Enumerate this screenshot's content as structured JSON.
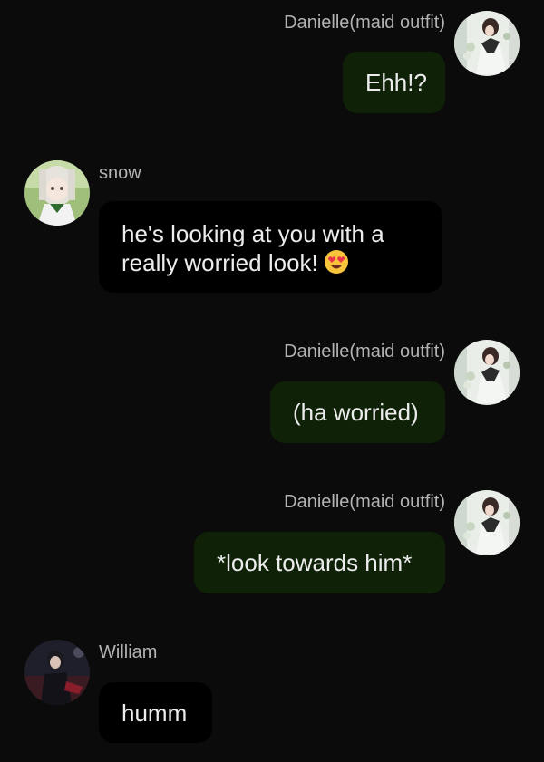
{
  "colors": {
    "background": "#0b0b0b",
    "outgoing_bubble": "#0f2208",
    "incoming_bubble": "#000000",
    "sender_name": "#b3b3b3",
    "message_text": "#ececec"
  },
  "messages": [
    {
      "sender": "Danielle(maid outfit)",
      "text": "Ehh!?",
      "side": "right",
      "avatar": "danielle-avatar"
    },
    {
      "sender": "snow",
      "text_line1": "he's looking at you with a",
      "text_line2": "really worried look!",
      "emoji": "heart-eyes-emoji",
      "side": "left",
      "avatar": "snow-avatar"
    },
    {
      "sender": "Danielle(maid outfit)",
      "text": "(ha worried)",
      "side": "right",
      "avatar": "danielle-avatar"
    },
    {
      "sender": "Danielle(maid outfit)",
      "text": "*look towards him*",
      "side": "right",
      "avatar": "danielle-avatar"
    },
    {
      "sender": "William",
      "text": "humm",
      "side": "left",
      "avatar": "william-avatar"
    }
  ]
}
